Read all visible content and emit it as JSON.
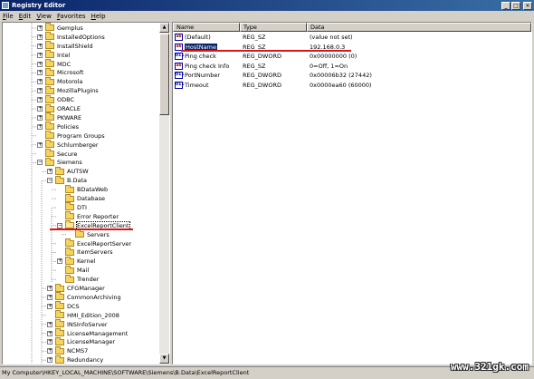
{
  "window": {
    "title": "Registry Editor",
    "minimize": "_",
    "maximize": "□",
    "close": "✕"
  },
  "menu": [
    {
      "label": "File",
      "u": "F",
      "rest": "ile"
    },
    {
      "label": "Edit",
      "u": "E",
      "rest": "dit"
    },
    {
      "label": "View",
      "u": "V",
      "rest": "iew"
    },
    {
      "label": "Favorites",
      "u": "F",
      "rest": "avorites",
      "pre": ""
    },
    {
      "label": "Help",
      "u": "H",
      "rest": "elp"
    }
  ],
  "tree": [
    {
      "label": "Gemplus",
      "level": 0,
      "expander": "+"
    },
    {
      "label": "InstalledOptions",
      "level": 0,
      "expander": "+"
    },
    {
      "label": "InstallShield",
      "level": 0,
      "expander": "+"
    },
    {
      "label": "Intel",
      "level": 0,
      "expander": "+"
    },
    {
      "label": "MDC",
      "level": 0,
      "expander": "+"
    },
    {
      "label": "Microsoft",
      "level": 0,
      "expander": "+"
    },
    {
      "label": "Motorola",
      "level": 0,
      "expander": "+"
    },
    {
      "label": "MozillaPlugins",
      "level": 0,
      "expander": "+"
    },
    {
      "label": "ODBC",
      "level": 0,
      "expander": "+"
    },
    {
      "label": "ORACLE",
      "level": 0,
      "expander": "+"
    },
    {
      "label": "PKWARE",
      "level": 0,
      "expander": "+"
    },
    {
      "label": "Policies",
      "level": 0,
      "expander": "+"
    },
    {
      "label": "Program Groups",
      "level": 0,
      "expander": ""
    },
    {
      "label": "Schlumberger",
      "level": 0,
      "expander": "+"
    },
    {
      "label": "Secure",
      "level": 0,
      "expander": ""
    },
    {
      "label": "Siemens",
      "level": 0,
      "expander": "−"
    },
    {
      "label": "AUTSW",
      "level": 1,
      "expander": "+"
    },
    {
      "label": "B.Data",
      "level": 1,
      "expander": "−"
    },
    {
      "label": "BDataWeb",
      "level": 2,
      "expander": ""
    },
    {
      "label": "Database",
      "level": 2,
      "expander": ""
    },
    {
      "label": "DTI",
      "level": 2,
      "expander": ""
    },
    {
      "label": "Error Reporter",
      "level": 2,
      "expander": ""
    },
    {
      "label": "ExcelReportClient",
      "level": 2,
      "expander": "−",
      "open": true,
      "selected": true
    },
    {
      "label": "Servers",
      "level": 3,
      "expander": ""
    },
    {
      "label": "ExcelReportServer",
      "level": 2,
      "expander": ""
    },
    {
      "label": "ItemServers",
      "level": 2,
      "expander": ""
    },
    {
      "label": "Kernel",
      "level": 2,
      "expander": "+"
    },
    {
      "label": "Mail",
      "level": 2,
      "expander": ""
    },
    {
      "label": "Trender",
      "level": 2,
      "expander": ""
    },
    {
      "label": "CFGManager",
      "level": 1,
      "expander": "+"
    },
    {
      "label": "CommonArchiving",
      "level": 1,
      "expander": "+"
    },
    {
      "label": "DCS",
      "level": 1,
      "expander": "+"
    },
    {
      "label": "HMI_Edition_2008",
      "level": 1,
      "expander": ""
    },
    {
      "label": "INSInfoServer",
      "level": 1,
      "expander": "+"
    },
    {
      "label": "LicenseManagement",
      "level": 1,
      "expander": "+"
    },
    {
      "label": "LicenseManager",
      "level": 1,
      "expander": "+"
    },
    {
      "label": "NCMS7",
      "level": 1,
      "expander": "+"
    },
    {
      "label": "Redundancy",
      "level": 1,
      "expander": "+"
    }
  ],
  "list": {
    "columns": [
      "Name",
      "Type",
      "Data"
    ],
    "rows": [
      {
        "name": "(Default)",
        "type": "REG_SZ",
        "data": "(value not set)",
        "icon": "ab"
      },
      {
        "name": "HostName",
        "type": "REG_SZ",
        "data": "192.168.0.3",
        "icon": "ab",
        "selected": true
      },
      {
        "name": "Ping check",
        "type": "REG_DWORD",
        "data": "0x00000000 (0)",
        "icon": "bin"
      },
      {
        "name": "Ping check Info",
        "type": "REG_SZ",
        "data": "0=Off, 1=On",
        "icon": "ab"
      },
      {
        "name": "PortNumber",
        "type": "REG_DWORD",
        "data": "0x00006b32 (27442)",
        "icon": "bin"
      },
      {
        "name": "Timeout",
        "type": "REG_DWORD",
        "data": "0x0000ea60 (60000)",
        "icon": "bin"
      }
    ]
  },
  "status": "My Computer\\HKEY_LOCAL_MACHINE\\SOFTWARE\\Siemens\\B.Data\\ExcelReportClient",
  "watermark": "www.321gk.com",
  "colors": {
    "annotation": "#d81818",
    "selection": "#0a246a"
  }
}
